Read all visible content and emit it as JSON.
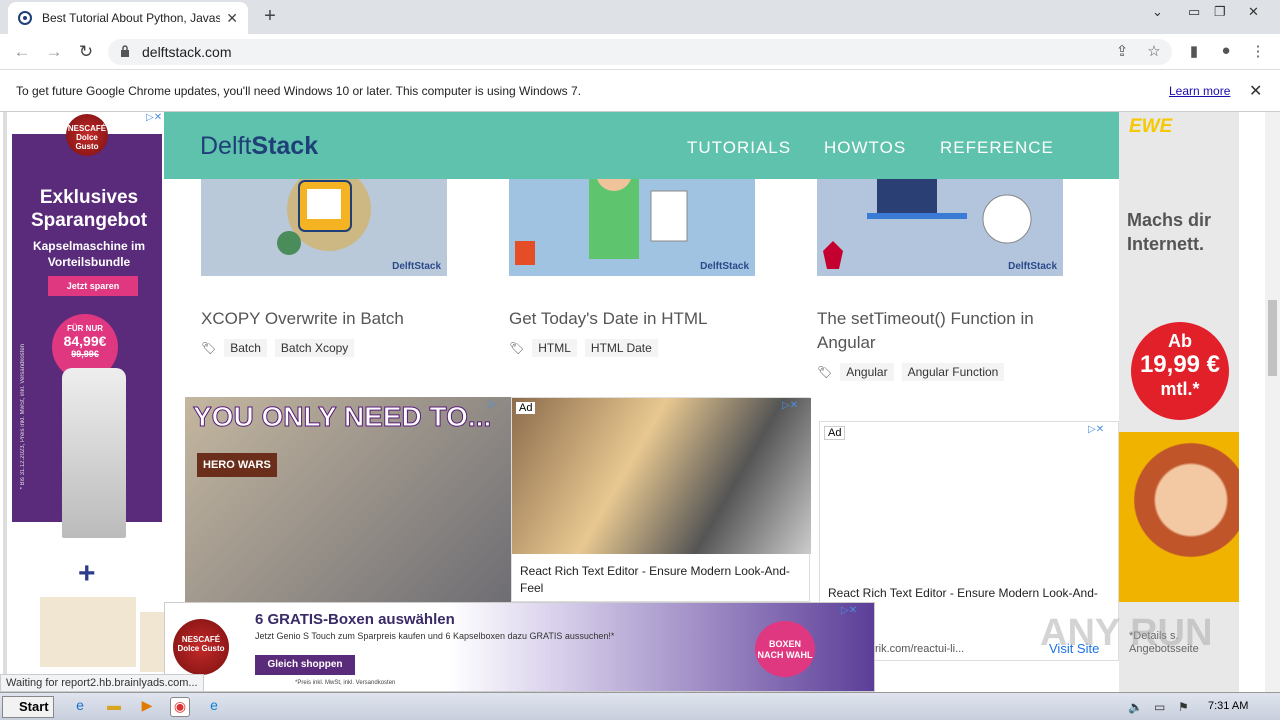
{
  "browser": {
    "tab_title": "Best Tutorial About Python, Javascri",
    "url": "delftstack.com",
    "infobar_message": "To get future Google Chrome updates, you'll need Windows 10 or later. This computer is using Windows 7.",
    "infobar_link": "Learn more",
    "status": "Waiting for report2.hb.brainlyads.com..."
  },
  "site": {
    "logo_a": "Delft",
    "logo_b": "Stack",
    "nav": [
      "TUTORIALS",
      "HOWTOS",
      "REFERENCE"
    ],
    "watermark": "DelftStack",
    "cards": [
      {
        "title": "XCOPY Overwrite in Batch",
        "tags": [
          "Batch",
          "Batch Xcopy"
        ]
      },
      {
        "title": "Get Today's Date in HTML",
        "tags": [
          "HTML",
          "HTML Date"
        ]
      },
      {
        "title": "The setTimeout() Function in Angular",
        "tags": [
          "Angular",
          "Angular Function"
        ]
      }
    ]
  },
  "ads": {
    "left": {
      "brand": "NESCAFÉ Dolce Gusto",
      "headline": "Exklusives Sparangebot",
      "sub": "Kapselmaschine im Vorteilsbundle",
      "button": "Jetzt sparen",
      "price_label": "FÜR NUR",
      "price": "84,99€",
      "old_price": "99,99€",
      "fine": "* Bis 31.12.2023, Preis inkl. MwSt, inkl. Versandkosten"
    },
    "hero": {
      "headline": "YOU ONLY NEED TO...",
      "brand": "HERO WARS"
    },
    "mid": {
      "label": "Ad",
      "caption": "React Rich Text Editor - Ensure Modern Look-And-Feel"
    },
    "right_inline": {
      "label": "Ad",
      "caption": "React Rich Text Editor - Ensure Modern Look-And-",
      "url": "rik.com/reactui-li...",
      "visit": "Visit Site"
    },
    "right": {
      "brand": "EWE",
      "headline": "Machs dir Internett.",
      "circle_a": "Ab",
      "circle_price": "19,99 €",
      "circle_b": "mtl.*",
      "details": "*Details s. Angebotsseite"
    },
    "bottom": {
      "headline": "6 GRATIS-Boxen auswählen",
      "sub": "Jetzt Genio S Touch zum Sparpreis kaufen und 6 Kapselboxen dazu GRATIS aussuchen!*",
      "button": "Gleich shoppen",
      "fine": "*Preis inkl. MwSt, inkl. Versandkosten",
      "badge": "BOXEN NACH WAHL"
    },
    "watermark": "ANY RUN"
  },
  "taskbar": {
    "start": "Start",
    "time": "7:31 AM"
  }
}
